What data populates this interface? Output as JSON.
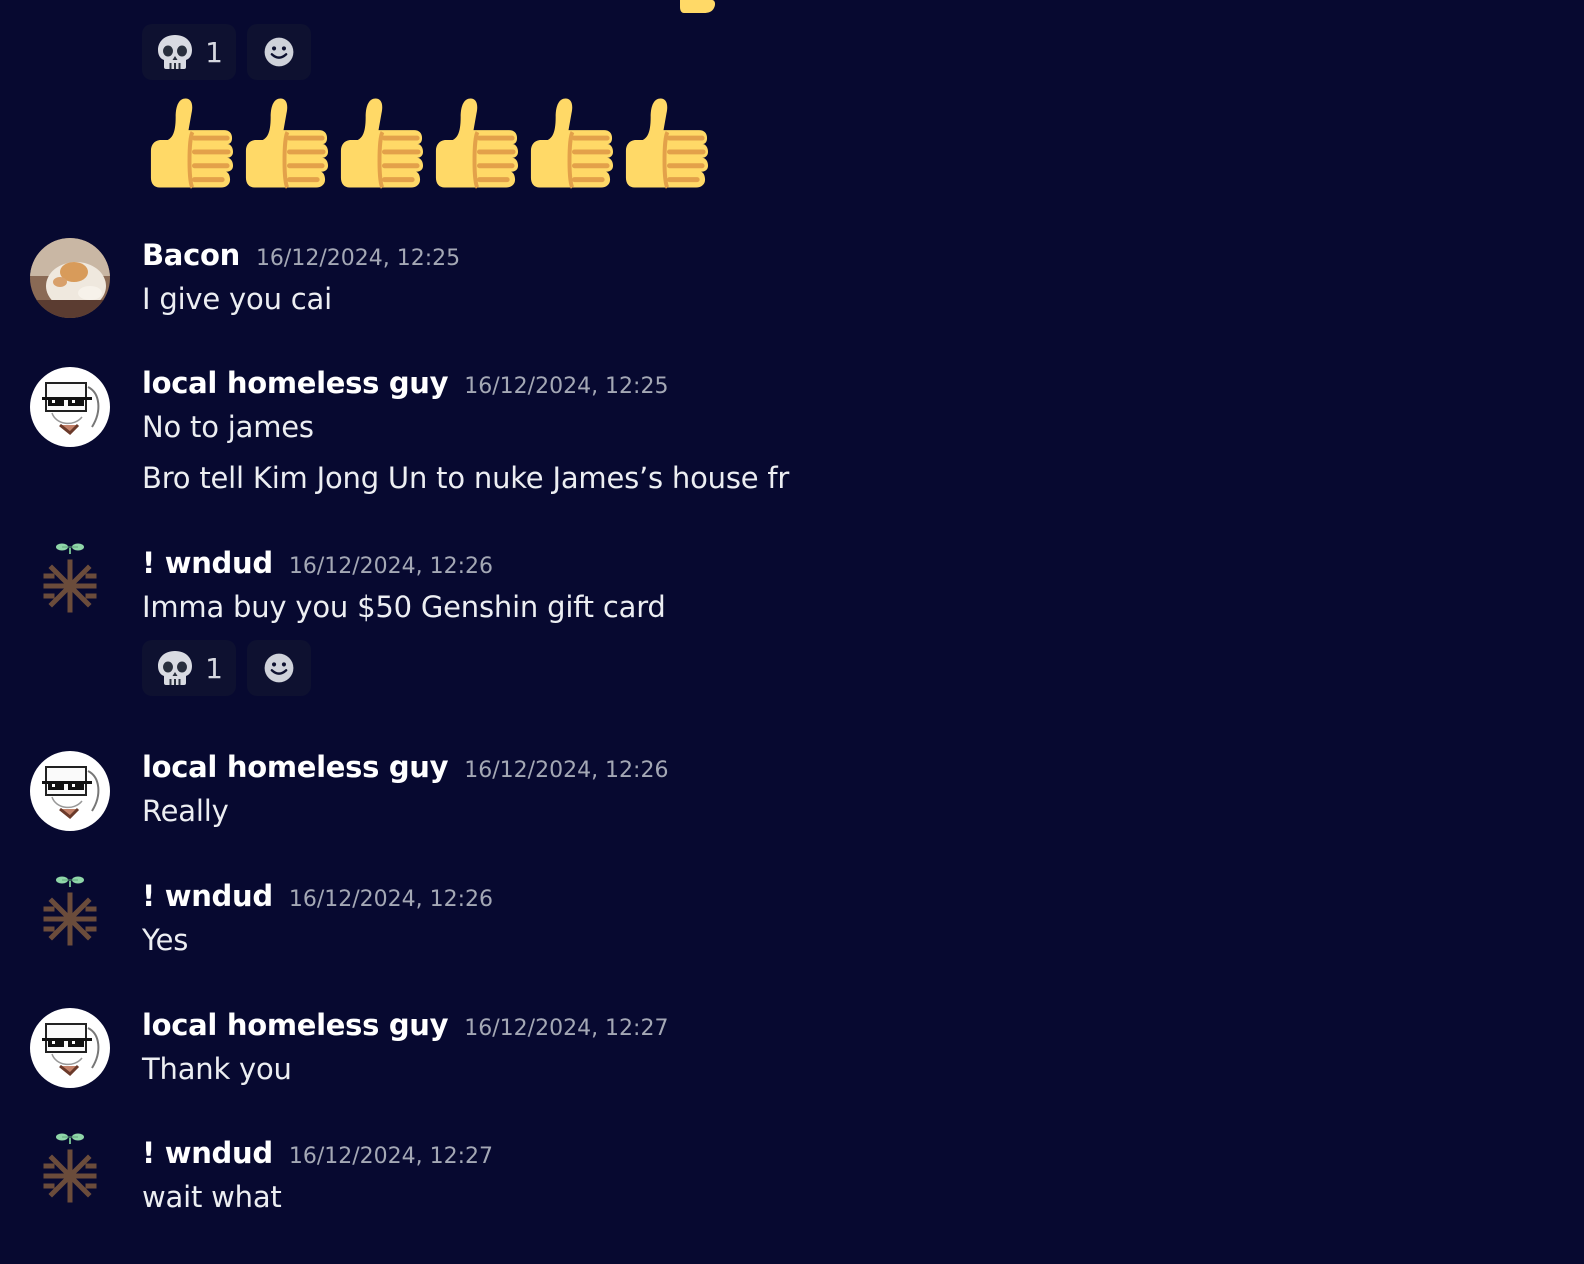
{
  "colors": {
    "background": "#070930",
    "username": "#ffffff",
    "timestamp": "#a4a8b5",
    "message_text": "#eceef2",
    "reaction_bg": "#0e1130"
  },
  "top_reactions": [
    {
      "icon": "skull-icon",
      "count": "1"
    },
    {
      "icon": "add-reaction-smile-icon"
    }
  ],
  "thumbs_emoji": {
    "icon": "thumbs-up-icon",
    "count": 6
  },
  "messages": [
    {
      "author": "Bacon",
      "timestamp": "16/12/2024, 12:25",
      "avatar": "cat-avatar",
      "lines": [
        "I give you cai"
      ]
    },
    {
      "author": "local homeless guy",
      "timestamp": "16/12/2024, 12:25",
      "avatar": "sunglasses-avatar",
      "lines": [
        "No to james",
        "Bro tell Kim Jong Un to nuke James’s house fr"
      ]
    },
    {
      "author": "! wndud",
      "timestamp": "16/12/2024, 12:26",
      "avatar": "sprout-avatar",
      "lines": [
        "Imma buy you $50 Genshin gift card"
      ],
      "reactions": [
        {
          "icon": "skull-icon",
          "count": "1"
        },
        {
          "icon": "add-reaction-smile-icon"
        }
      ]
    },
    {
      "author": "local homeless guy",
      "timestamp": "16/12/2024, 12:26",
      "avatar": "sunglasses-avatar",
      "lines": [
        "Really"
      ]
    },
    {
      "author": "! wndud",
      "timestamp": "16/12/2024, 12:26",
      "avatar": "sprout-avatar",
      "lines": [
        "Yes"
      ]
    },
    {
      "author": "local homeless guy",
      "timestamp": "16/12/2024, 12:27",
      "avatar": "sunglasses-avatar",
      "lines": [
        "Thank you"
      ]
    },
    {
      "author": "! wndud",
      "timestamp": "16/12/2024, 12:27",
      "avatar": "sprout-avatar",
      "lines": [
        "wait what"
      ]
    }
  ]
}
